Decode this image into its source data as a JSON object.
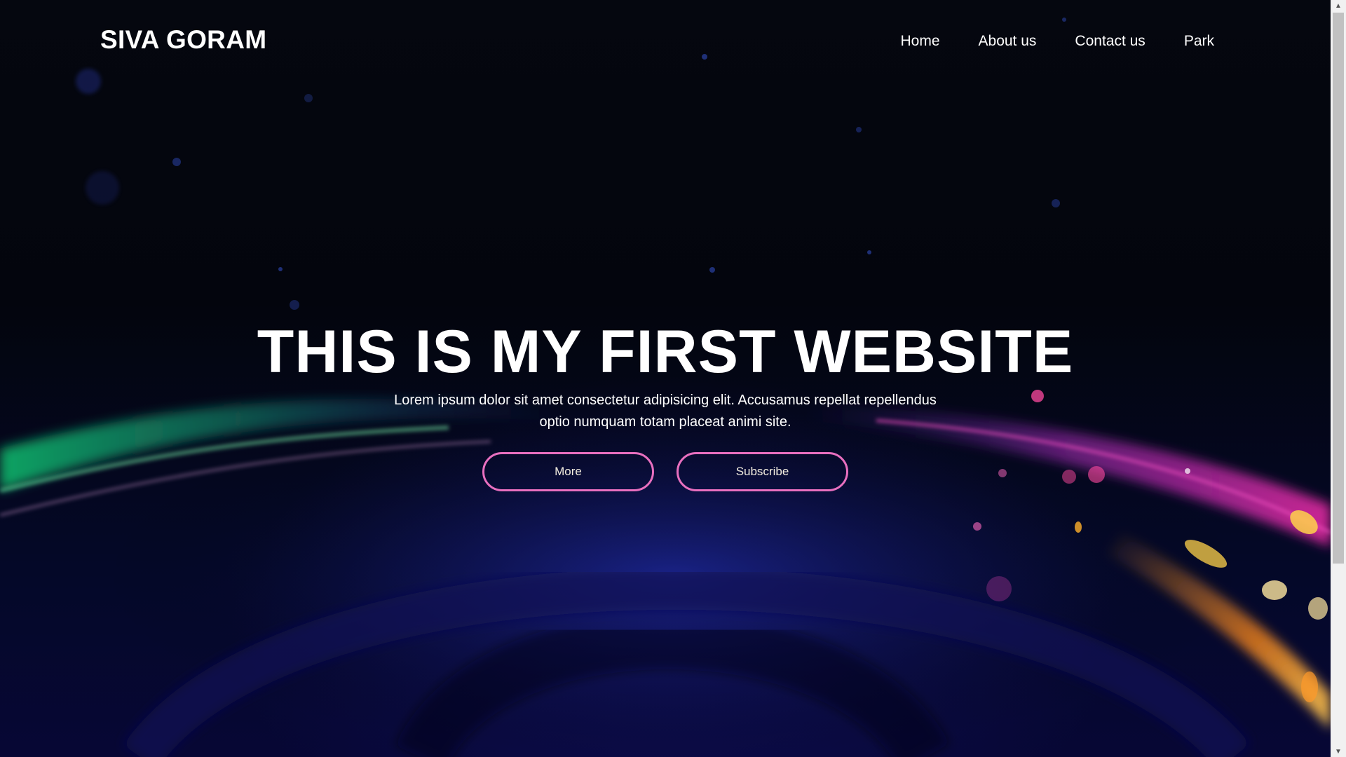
{
  "header": {
    "logo": "SIVA GORAM",
    "nav": [
      "Home",
      "About us",
      "Contact us",
      "Park"
    ]
  },
  "hero": {
    "title": "THIS IS MY FIRST WEBSITE",
    "description": "Lorem ipsum dolor sit amet consectetur adipisicing elit. Accusamus repellat repellendus optio numquam totam placeat animi site.",
    "buttons": [
      "More",
      "Subscribe"
    ]
  },
  "icons": {
    "scroll_up": "arrow-up-icon",
    "scroll_down": "arrow-down-icon"
  },
  "colors": {
    "button_border": "#e86fbf",
    "background": "#03050d",
    "text": "#ffffff"
  }
}
